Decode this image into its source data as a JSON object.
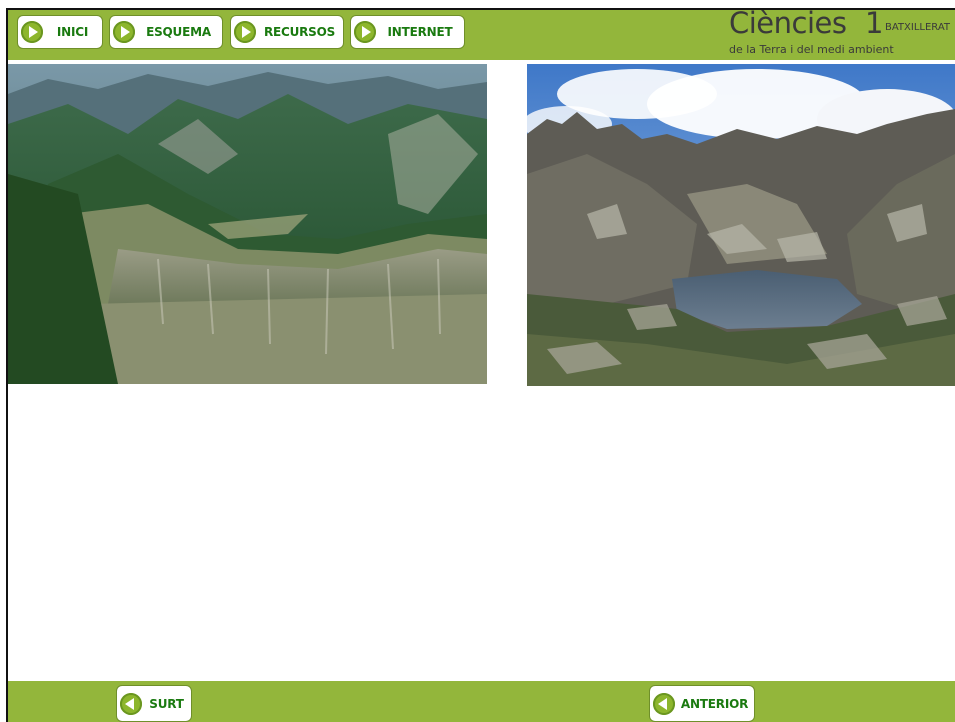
{
  "nav": {
    "inici": "INICI",
    "esquema": "ESQUEMA",
    "recursos": "RECURSOS",
    "internet": "INTERNET"
  },
  "brand": {
    "title": "Ciències",
    "number": "1",
    "level": "BATXILLERAT",
    "subtitle": "de la Terra i del medi ambient"
  },
  "footer": {
    "exit": "SURT",
    "previous": "ANTERIOR"
  },
  "colors": {
    "bar": "#93b63b",
    "button_text": "#1a7a10",
    "icon": "#8db62d"
  },
  "icons": {
    "forward": "play-right-icon",
    "back": "play-left-icon"
  }
}
